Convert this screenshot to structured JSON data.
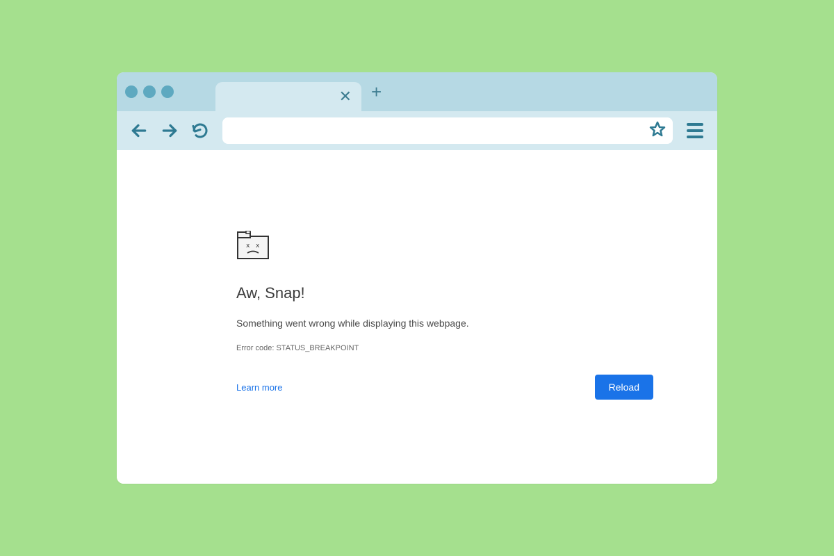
{
  "error": {
    "heading": "Aw, Snap!",
    "message": "Something went wrong while displaying this webpage.",
    "code_line": "Error code: STATUS_BREAKPOINT",
    "learn_more": "Learn more",
    "reload": "Reload"
  },
  "address_bar": {
    "value": ""
  }
}
